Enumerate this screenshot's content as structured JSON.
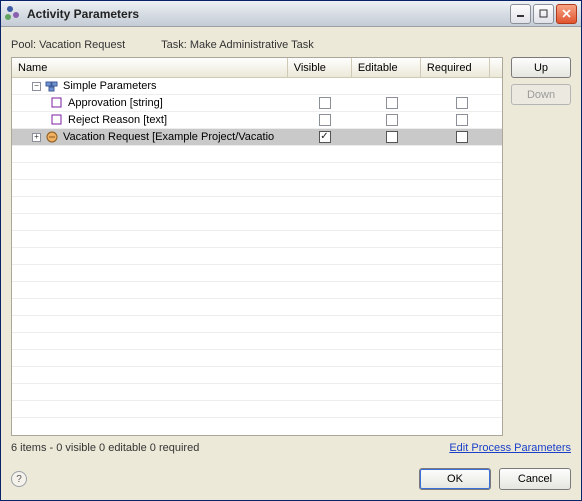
{
  "window": {
    "title": "Activity Parameters"
  },
  "meta": {
    "pool_label": "Pool:",
    "pool_value": "Vacation Request",
    "task_label": "Task:",
    "task_value": "Make Administrative Task"
  },
  "columns": {
    "name": "Name",
    "visible": "Visible",
    "editable": "Editable",
    "required": "Required"
  },
  "tree": {
    "group_label": "Simple Parameters",
    "rows": [
      {
        "label": "Approvation [string]",
        "visible": false,
        "editable": false,
        "required": false
      },
      {
        "label": "Reject Reason [text]",
        "visible": false,
        "editable": false,
        "required": false
      }
    ],
    "selected": {
      "label": "Vacation Request [Example Project/Vacatio",
      "visible": true,
      "editable": false,
      "required": false
    }
  },
  "side": {
    "up": "Up",
    "down": "Down"
  },
  "status": "6 items - 0 visible  0 editable  0 required",
  "link": "Edit Process Parameters",
  "footer": {
    "ok": "OK",
    "cancel": "Cancel"
  }
}
